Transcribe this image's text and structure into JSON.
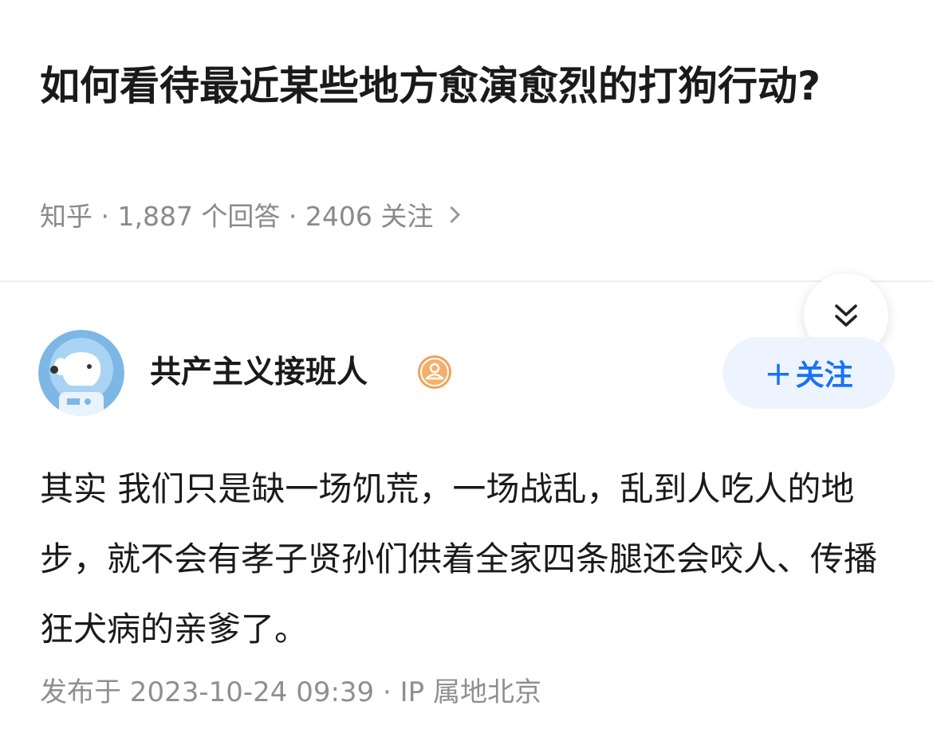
{
  "question": {
    "title": "如何看待最近某些地方愈演愈烈的打狗行动?",
    "meta": "知乎 · 1,887 个回答 · 2406 关注"
  },
  "answer": {
    "author": {
      "name": "共产主义接班人",
      "follow_label": "关注"
    },
    "body": "其实 我们只是缺一场饥荒，一场战乱，乱到人吃人的地步，就不会有孝子贤孙们供着全家四条腿还会咬人、传播狂犬病的亲爹了。",
    "meta": "发布于 2023-10-24 09:39 · IP 属地北京"
  },
  "icons": {
    "collapse": "double-chevron-down-icon",
    "badge": "user-badge-icon",
    "meta_arrow": "chevron-right-icon"
  },
  "colors": {
    "accent": "#1772f6",
    "follow_bg": "#eef4ff",
    "badge": "#f0a15a"
  }
}
